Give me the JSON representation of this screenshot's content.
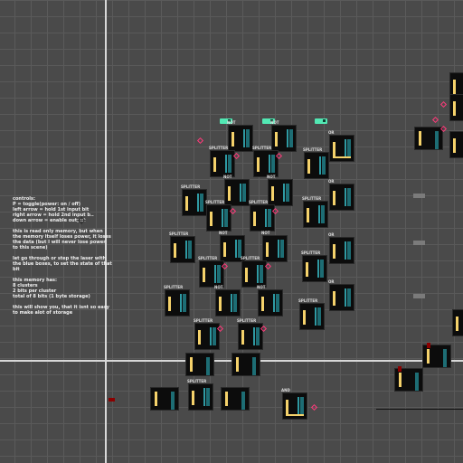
{
  "instructions": {
    "heading": "controls:",
    "controls": [
      "P = toggle(power: on / off)",
      "left arrow = hold 1st input bit",
      "right arrow = hold 2nd input b..",
      "down arrow = enable output"
    ],
    "paragraph1": "this is read only memory, but when the memory itself loses power, it loses the data (but I will never lose power to this scene)",
    "paragraph2": "let go through or step the laser with the blue boxes, to set the state of that bit",
    "memory_heading": "this memory has:",
    "memory_lines": [
      "8 clusters",
      "2 bits per cluster",
      "total of 8 bits (1 byte storage)"
    ],
    "paragraph3": "this will show you, that it isnt so easy to make alot of storage"
  },
  "gate_labels": {
    "splitter": "SPLITTER",
    "not": "NOT",
    "or": "OR",
    "and": "AND"
  },
  "colors": {
    "background": "#4a4a4a",
    "grid": "#5a5a5a",
    "gate_body": "#0c0c0c",
    "input_bar": "#f5d26b",
    "laser_bar": "#1d6d74",
    "diamond": "#ff3a7a",
    "switch": "#52e8b3",
    "axis": "#d8d8d8"
  }
}
